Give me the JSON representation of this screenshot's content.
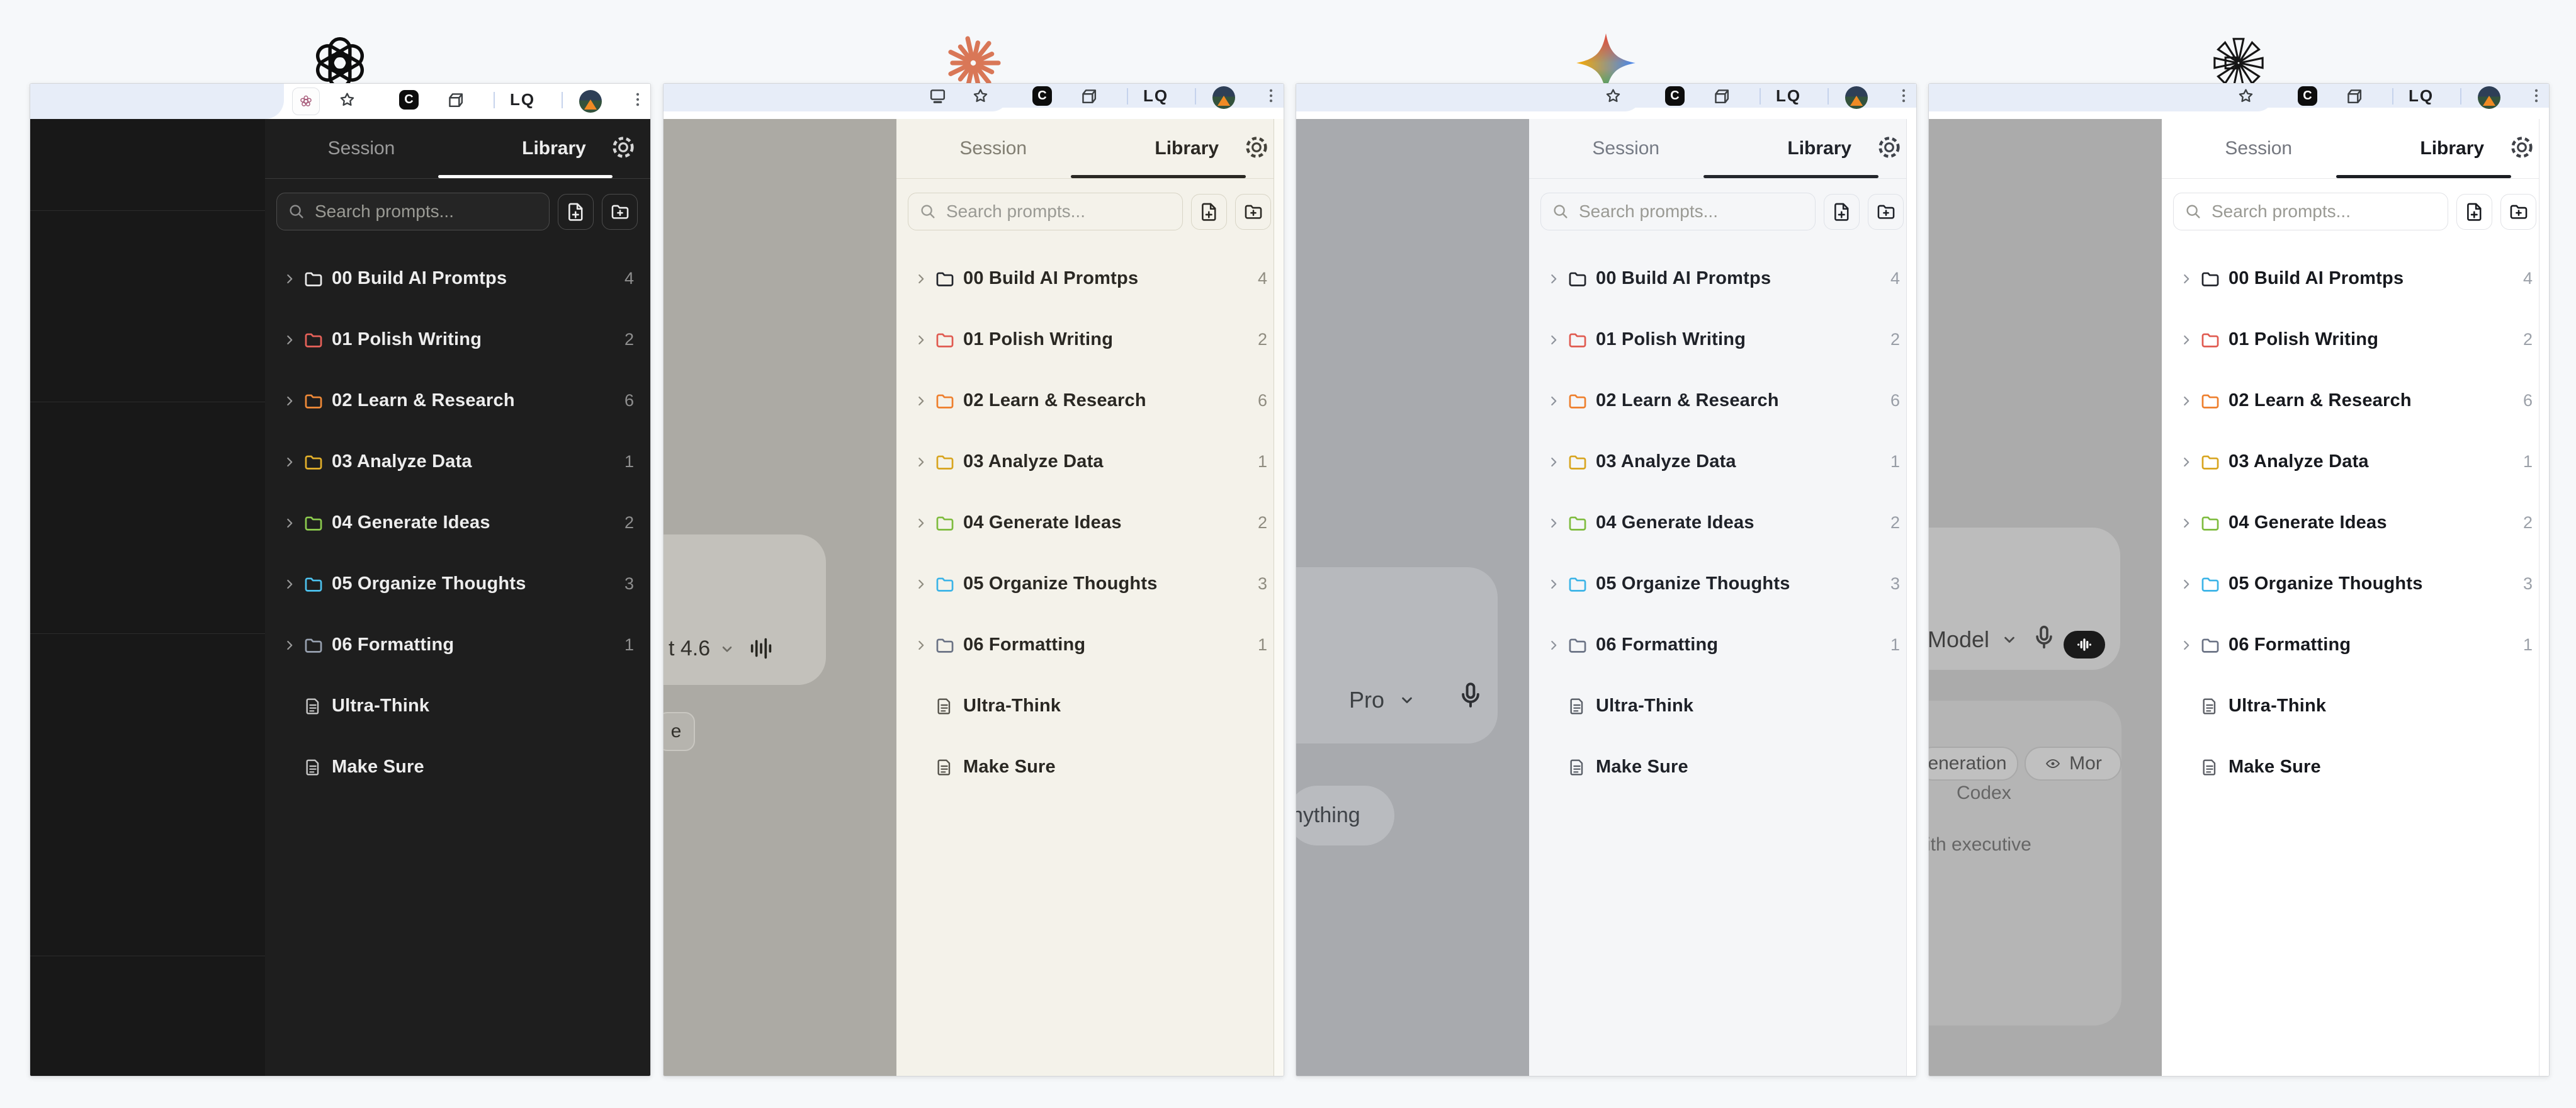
{
  "canvas": {
    "background": "#f6f8fa",
    "window_border": "#d4d6d9",
    "tab_blue": "#e7edf8"
  },
  "toolbar": {
    "bookmark_label": "LQ"
  },
  "extension": {
    "tabs": {
      "session": "Session",
      "library": "Library",
      "active": "Library"
    },
    "search_placeholder": "Search prompts...",
    "folders": [
      {
        "name": "00 Build AI Promtps",
        "count": "4",
        "color": "default"
      },
      {
        "name": "01 Polish Writing",
        "count": "2",
        "color": "red"
      },
      {
        "name": "02 Learn & Research",
        "count": "6",
        "color": "orange"
      },
      {
        "name": "03 Analyze Data",
        "count": "1",
        "color": "yellow"
      },
      {
        "name": "04 Generate Ideas",
        "count": "2",
        "color": "green"
      },
      {
        "name": "05 Organize Thoughts",
        "count": "3",
        "color": "blue"
      },
      {
        "name": "06 Formatting",
        "count": "1",
        "color": "gray"
      }
    ],
    "files": [
      "Ultra-Think",
      "Make Sure"
    ]
  },
  "panels": [
    {
      "site": "chatgpt",
      "logo": "openai-logo",
      "theme": "dark",
      "page": {
        "type": "dark-sidebar"
      }
    },
    {
      "site": "claude",
      "logo": "claude-starburst-logo",
      "theme": "cream",
      "page": {
        "type": "claude-composer",
        "model_text": "t 4.6",
        "chip_text": "e"
      }
    },
    {
      "site": "gemini",
      "logo": "gemini-star-logo",
      "theme": "gemini",
      "page": {
        "type": "gemini-composer",
        "model_text": "Pro",
        "chip_text": "nything"
      }
    },
    {
      "site": "pinwheel",
      "logo": "pinwheel-star-logo",
      "theme": "white",
      "page": {
        "type": "composer-cards",
        "model_text": "Model",
        "chips": [
          "eneration",
          "Mor"
        ],
        "items": [
          "Codex",
          "ith executive"
        ]
      }
    }
  ],
  "colors": {
    "claude_brand": "#d97757",
    "folder_light": {
      "default": "#22252c",
      "red": "#e05a50",
      "orange": "#ee7f2d",
      "yellow": "#d8a520",
      "green": "#7fbc3f",
      "blue": "#3cb4e7",
      "gray": "#6b7385"
    },
    "folder_dark": {
      "default": "#ececec",
      "red": "#e8625a",
      "orange": "#f08a38",
      "yellow": "#e3b02a",
      "green": "#8ccb4e",
      "blue": "#4cc2ef",
      "gray": "#98a1b0"
    },
    "themes": {
      "dark": {
        "panel": "#1e1e1e",
        "strip": "#181818",
        "hair": "#3a3a3a",
        "text": "#ededed",
        "inactive": "#9a9a9a",
        "count": "#8f8f8f",
        "border": "#4c4c4c",
        "underline": "#fafafa",
        "gear": "#d6d6d6",
        "chev": "#9a9a9a",
        "doc": "#c7c7c7"
      },
      "cream": {
        "panel": "#f4f2ea",
        "strip": "#acaaa4",
        "hair": "#e0ddd0",
        "text": "#2a2823",
        "inactive": "#817e72",
        "count": "#8f8c80",
        "border": "#d8d5c6",
        "underline": "#2a2823",
        "gear": "#44423a",
        "chev": "#8f8c80",
        "doc": "#56544c",
        "stripBox": "#c3c1bb",
        "stripText": "#33312c",
        "scrollTrack": "#fbfaf5",
        "scrollLine": "#d9d6c8"
      },
      "gemini": {
        "panel": "#f5f6f8",
        "strip": "#a8aaae",
        "hair": "#e4e6ea",
        "text": "#1f2229",
        "inactive": "#767b85",
        "count": "#989da6",
        "border": "#dfe2e8",
        "underline": "#23262c",
        "gear": "#3f434b",
        "chev": "#8d929b",
        "doc": "#585d66",
        "stripBox": "#b7b9bd",
        "stripText": "#3c4043",
        "scrollTrack": "#ffffff",
        "scrollLine": "#e0e2e6"
      },
      "white": {
        "panel": "#ffffff",
        "strip": "#ababab",
        "hair": "#e8e8ea",
        "text": "#17191e",
        "inactive": "#74777f",
        "count": "#9ba0a8",
        "border": "#e1e2e6",
        "underline": "#1b1d22",
        "gear": "#3f4147",
        "chev": "#8f939b",
        "doc": "#5a5d64",
        "stripBox": "#bcbcbc",
        "stripCard": "#b5b5b5",
        "stripText": "#3f3f3f",
        "scrollTrack": "#ffffff",
        "scrollLine": "#e4e4e7"
      }
    }
  }
}
